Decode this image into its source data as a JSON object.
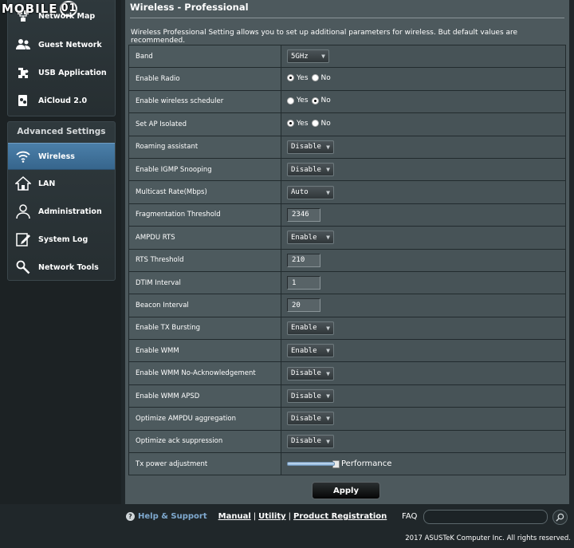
{
  "watermark": {
    "text": "MOBILE",
    "ring": "01"
  },
  "sidebar": {
    "general_items": [
      {
        "label": "Network Map",
        "icon": "network-map-icon"
      },
      {
        "label": "Guest Network",
        "icon": "guest-network-icon"
      },
      {
        "label": "USB Application",
        "icon": "usb-icon"
      },
      {
        "label": "AiCloud 2.0",
        "icon": "cloud-icon"
      }
    ],
    "advanced_title": "Advanced Settings",
    "advanced_items": [
      {
        "label": "Wireless",
        "icon": "wifi-icon",
        "active": true
      },
      {
        "label": "LAN",
        "icon": "home-icon"
      },
      {
        "label": "Administration",
        "icon": "admin-user-icon"
      },
      {
        "label": "System Log",
        "icon": "system-log-icon"
      },
      {
        "label": "Network Tools",
        "icon": "network-tools-icon"
      }
    ]
  },
  "panel": {
    "title": "Wireless - Professional",
    "description": "Wireless Professional Setting allows you to set up additional parameters for wireless. But default values are recommended."
  },
  "settings": {
    "band": {
      "label": "Band",
      "value": "5GHz"
    },
    "enable_radio": {
      "label": "Enable Radio",
      "yes": "Yes",
      "no": "No",
      "selected": "Yes"
    },
    "wireless_scheduler": {
      "label": "Enable wireless scheduler",
      "yes": "Yes",
      "no": "No",
      "selected": "No"
    },
    "ap_isolated": {
      "label": "Set AP Isolated",
      "yes": "Yes",
      "no": "No",
      "selected": "Yes"
    },
    "roaming_assistant": {
      "label": "Roaming assistant",
      "value": "Disable"
    },
    "igmp_snooping": {
      "label": "Enable IGMP Snooping",
      "value": "Disable"
    },
    "multicast_rate": {
      "label": "Multicast Rate(Mbps)",
      "value": "Auto"
    },
    "fragmentation_threshold": {
      "label": "Fragmentation Threshold",
      "value": "2346"
    },
    "ampdu_rts": {
      "label": "AMPDU RTS",
      "value": "Enable"
    },
    "rts_threshold": {
      "label": "RTS Threshold",
      "value": "210"
    },
    "dtim_interval": {
      "label": "DTIM Interval",
      "value": "1"
    },
    "beacon_interval": {
      "label": "Beacon Interval",
      "value": "20"
    },
    "tx_bursting": {
      "label": "Enable TX Bursting",
      "value": "Enable"
    },
    "wmm": {
      "label": "Enable WMM",
      "value": "Enable"
    },
    "wmm_no_ack": {
      "label": "Enable WMM No-Acknowledgement",
      "value": "Disable"
    },
    "wmm_apsd": {
      "label": "Enable WMM APSD",
      "value": "Disable"
    },
    "ampdu_aggregation": {
      "label": "Optimize AMPDU aggregation",
      "value": "Disable"
    },
    "ack_suppression": {
      "label": "Optimize ack suppression",
      "value": "Disable"
    },
    "tx_power": {
      "label": "Tx power adjustment",
      "caption": "Performance",
      "level_fraction": 1.0
    }
  },
  "apply_label": "Apply",
  "footer": {
    "help_label": "Help & Support",
    "links": [
      "Manual",
      "Utility",
      "Product Registration"
    ],
    "faq_label": "FAQ",
    "copyright": "2017 ASUSTeK Computer Inc. All rights reserved."
  },
  "colors": {
    "panel_bg": "#4d595d",
    "active_menu": "#4b7fa9",
    "page_bg": "#20272a",
    "help_text": "#7fa9cf"
  }
}
